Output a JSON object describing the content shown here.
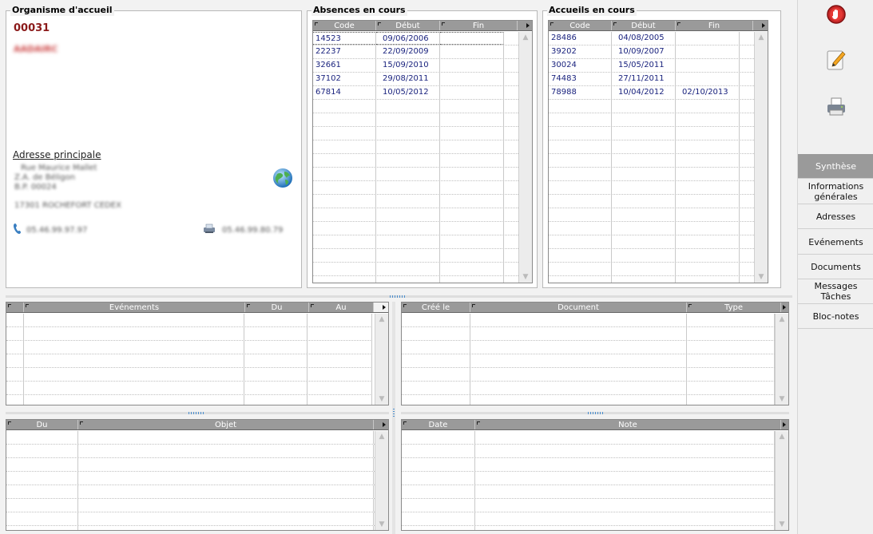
{
  "org": {
    "title": "Organisme d'accueil",
    "code": "00031",
    "name": "AADAIRC",
    "address_title": "Adresse principale",
    "address_lines": [
      "Rue Maurice Mallet",
      "Z.A. de Béligon",
      "B.P. 00024",
      "17301 ROCHEFORT CEDEX"
    ],
    "phone": "05.46.99.97.97",
    "fax": "05.46.99.80.79"
  },
  "absences": {
    "title": "Absences en cours",
    "columns": [
      "Code",
      "Début",
      "Fin"
    ],
    "rows": [
      [
        "14523",
        "09/06/2006",
        ""
      ],
      [
        "22237",
        "22/09/2009",
        ""
      ],
      [
        "32661",
        "15/09/2010",
        ""
      ],
      [
        "37102",
        "29/08/2011",
        ""
      ],
      [
        "67814",
        "10/05/2012",
        ""
      ]
    ]
  },
  "accueils": {
    "title": "Accueils en cours",
    "columns": [
      "Code",
      "Début",
      "Fin"
    ],
    "rows": [
      [
        "28486",
        "04/08/2005",
        ""
      ],
      [
        "39202",
        "10/09/2007",
        ""
      ],
      [
        "30024",
        "15/05/2011",
        ""
      ],
      [
        "74483",
        "27/11/2011",
        ""
      ],
      [
        "78988",
        "10/04/2012",
        "02/10/2013"
      ]
    ]
  },
  "events_grid": {
    "columns": [
      "Evénements",
      "Du",
      "Au"
    ]
  },
  "docs_grid": {
    "columns": [
      "Créé le",
      "Document",
      "Type"
    ]
  },
  "tasks_grid": {
    "columns": [
      "Du",
      "Objet"
    ]
  },
  "notes_grid": {
    "columns": [
      "Date",
      "Note"
    ]
  },
  "sidebar": {
    "tools": [
      "stop-icon",
      "edit-note-icon",
      "printer-icon"
    ],
    "nav": [
      {
        "label": "Synthèse",
        "active": true
      },
      {
        "label": "Informations générales"
      },
      {
        "label": "Adresses"
      },
      {
        "label": "Evénements"
      },
      {
        "label": "Documents"
      },
      {
        "label": "Messages Tâches"
      },
      {
        "label": "Bloc-notes"
      }
    ]
  },
  "colors": {
    "accent_dark_red": "#8b1a1a",
    "grid_header": "#9a9a9a",
    "cell_text": "#1a237e"
  }
}
